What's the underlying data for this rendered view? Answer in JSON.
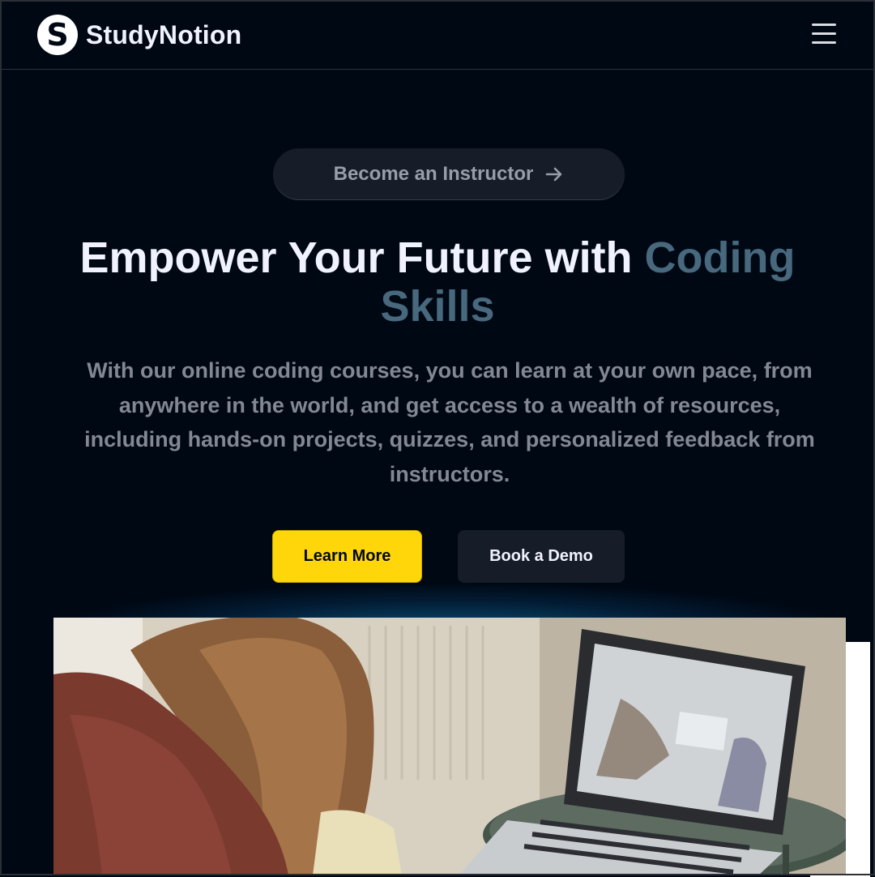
{
  "brand": {
    "logo_letter": "S",
    "name": "StudyNotion"
  },
  "header": {
    "menu_icon": "hamburger-menu-icon"
  },
  "hero": {
    "cta_pill": {
      "label": "Become an Instructor",
      "icon": "arrow-right-icon"
    },
    "headline": {
      "prefix": "Empower Your Future with ",
      "highlight": "Coding Skills"
    },
    "description": "With our online coding courses, you can learn at your own pace, from anywhere in the world, and get access to a wealth of resources, including hands-on projects, quizzes, and personalized feedback from instructors.",
    "buttons": {
      "primary": "Learn More",
      "secondary": "Book a Demo"
    }
  },
  "colors": {
    "background": "#000814",
    "accent_yellow": "#ffd60a",
    "highlight_blue": "#47687d",
    "muted_text": "#838894",
    "dark_button": "#161d29"
  }
}
